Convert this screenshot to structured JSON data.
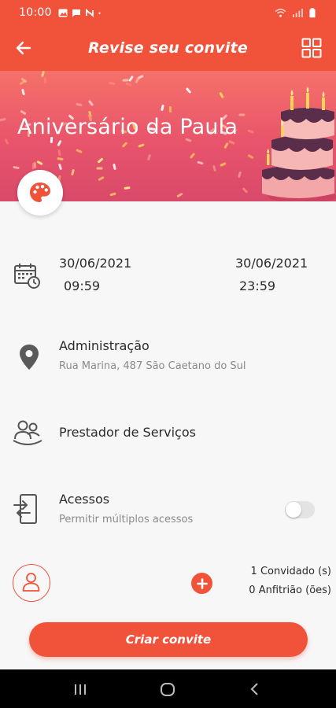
{
  "status_bar": {
    "time": "10:00",
    "left_icons": [
      "image-icon",
      "message-icon",
      "nfc-icon",
      "dot-icon"
    ],
    "right_icons": [
      "wifi-icon",
      "signal-icon",
      "battery-icon"
    ]
  },
  "app_bar": {
    "title": "Revise seu convite",
    "back_icon": "arrow-left-icon",
    "menu_icon": "grid-icon"
  },
  "banner": {
    "event_title": "Aniversário da Paula",
    "theme_button_icon": "palette-icon"
  },
  "dates": {
    "start_date": "30/06/2021",
    "start_time": "09:59",
    "end_date": "30/06/2021",
    "end_time": "23:59",
    "icon": "calendar-clock-icon"
  },
  "location": {
    "title": "Administração",
    "address": "Rua Marina, 487 São Caetano do Sul",
    "icon": "location-pin-icon"
  },
  "service": {
    "title": "Prestador de Serviços",
    "icon": "people-icon"
  },
  "access": {
    "title": "Acessos",
    "subtitle": "Permitir múltiplos acessos",
    "toggle_on": false,
    "icon": "device-transfer-icon"
  },
  "guests": {
    "guests_count": "1 Convidado (s)",
    "hosts_count": "0 Anfitrião (ões)",
    "avatar_icon": "user-icon",
    "add_icon": "plus-icon"
  },
  "cta": {
    "label": "Criar convite"
  },
  "colors": {
    "primary": "#f0533a",
    "banner_pink": "#e8546b",
    "toggle_off": "#e3e3e3"
  },
  "nav_bar": {
    "icons": [
      "recents-icon",
      "home-icon",
      "back-icon"
    ]
  }
}
